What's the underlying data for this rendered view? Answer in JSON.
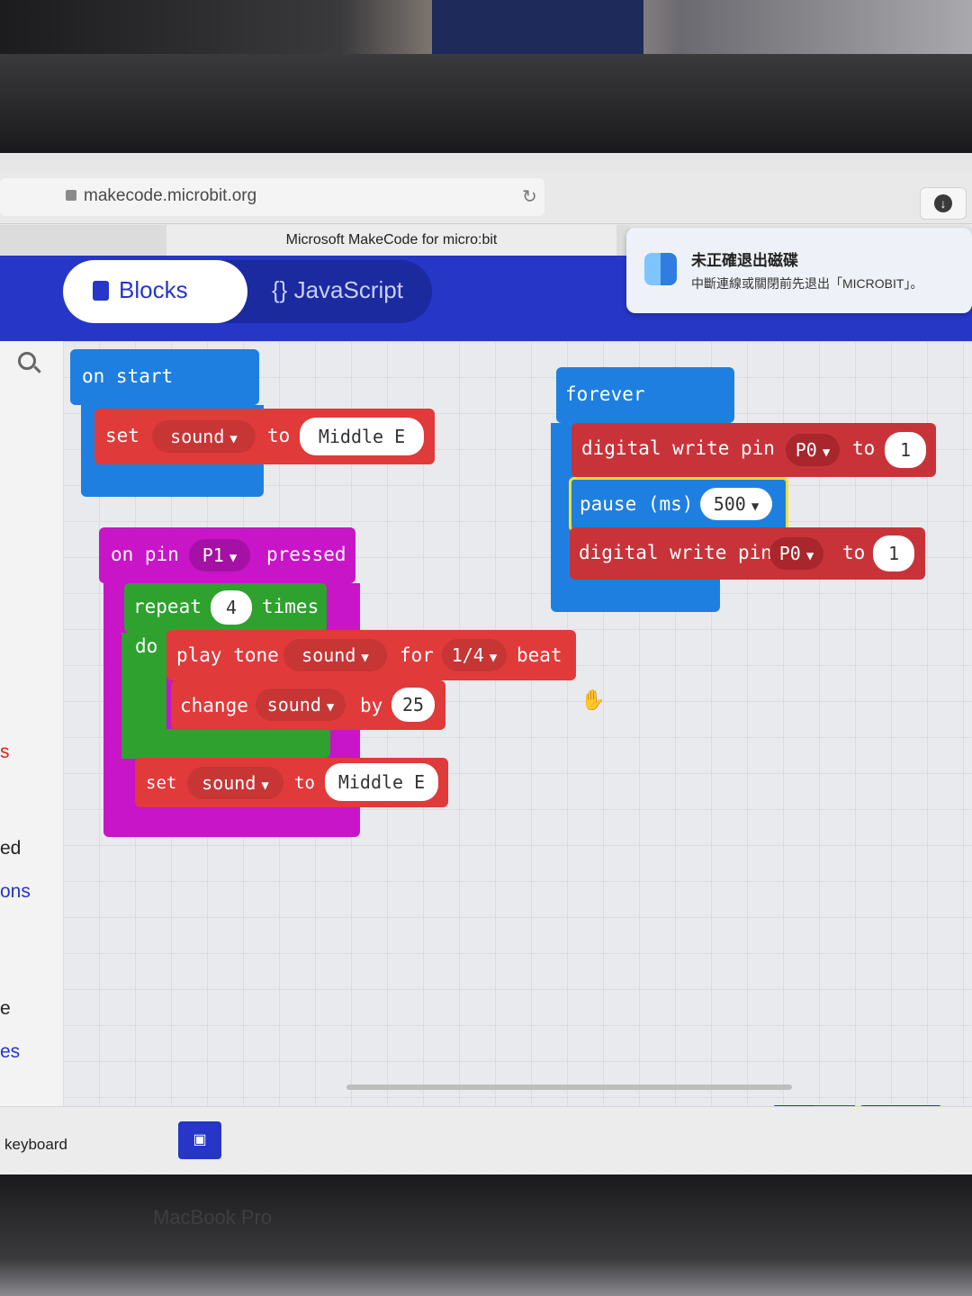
{
  "browser": {
    "url": "makecode.microbit.org",
    "tab_title": "Microsoft MakeCode for micro:bit"
  },
  "header": {
    "blocks_label": "Blocks",
    "javascript_label": "JavaScript"
  },
  "notification": {
    "title": "未正確退出磁碟",
    "body": "中斷連線或關閉前先退出「MICROBIT」。"
  },
  "toolbox": {
    "partial_items": [
      "s",
      "ed",
      "ons",
      "e",
      "es"
    ]
  },
  "blocks": {
    "on_start": {
      "hat": "on start",
      "set_kw": "set",
      "var": "sound",
      "to_kw": "to",
      "value": "Middle E"
    },
    "forever": {
      "hat": "forever",
      "write1_label": "digital write pin",
      "write1_pin": "P0",
      "write1_to": "to",
      "write1_value": "1",
      "pause_label": "pause (ms)",
      "pause_value": "500",
      "write2_label": "digital write pin",
      "write2_pin": "P0",
      "write2_to": "to",
      "write2_value": "1"
    },
    "on_pin": {
      "hat_prefix": "on pin",
      "pin": "P1",
      "hat_suffix": "pressed",
      "repeat_kw": "repeat",
      "repeat_count": "4",
      "times_kw": "times",
      "do_kw": "do",
      "play_label": "play tone",
      "play_var": "sound",
      "for_kw": "for",
      "beat_value": "1/4",
      "beat_kw": "beat",
      "change_kw": "change",
      "change_var": "sound",
      "by_kw": "by",
      "change_value": "25",
      "set_kw": "set",
      "set_var": "sound",
      "set_to": "to",
      "set_value": "Middle E"
    }
  },
  "footer": {
    "keyboard_label": "keyboard"
  },
  "device": {
    "label": "MacBook Pro"
  }
}
